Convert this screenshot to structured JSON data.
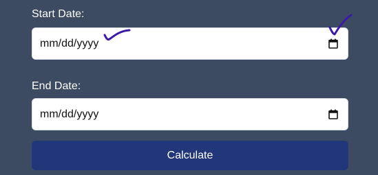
{
  "form": {
    "start_label": "Start Date:",
    "start_value": "mm/dd/yyyy",
    "end_label": "End Date:",
    "end_value": "mm/dd/yyyy",
    "calculate_label": "Calculate"
  },
  "icons": {
    "calendar": "calendar-icon",
    "annotation": "checkmark-annotation"
  },
  "colors": {
    "background": "#3c4b62",
    "field": "#ffffff",
    "button": "#22377a",
    "annotation": "#3b1aa8"
  }
}
